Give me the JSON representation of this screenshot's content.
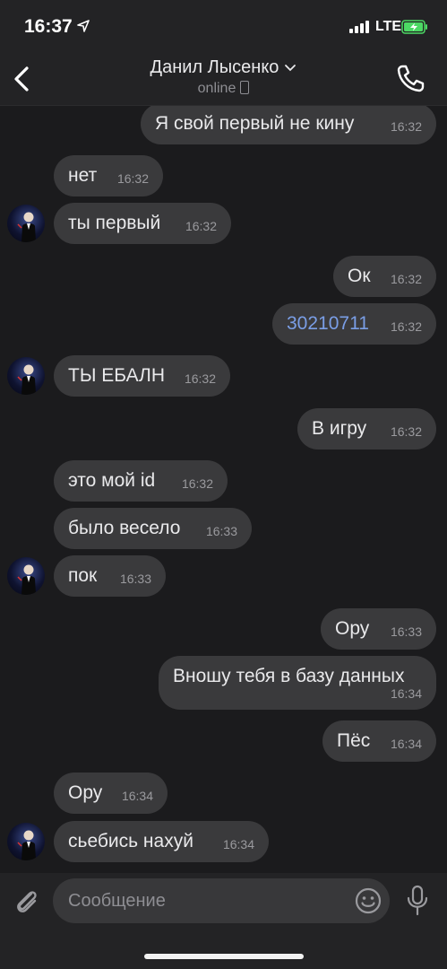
{
  "status_bar": {
    "time": "16:37",
    "network": "LTE",
    "icons": [
      "location-arrow-icon",
      "signal-bars-icon",
      "battery-charging-icon"
    ]
  },
  "header": {
    "back_icon": "chevron-left-icon",
    "contact_name": "Данил Лысенко",
    "contact_status": "online",
    "call_icon": "phone-icon"
  },
  "colors": {
    "background": "#1b1b1d",
    "bar": "#232325",
    "bubble": "#3a3a3c",
    "link": "#7a9ee6",
    "time": "#9a9a9e",
    "battery": "#4cd964"
  },
  "messages": [
    {
      "side": "out",
      "text": "Я свой первый не кину",
      "time": "16:32"
    },
    {
      "side": "in",
      "text": "нет",
      "time": "16:32"
    },
    {
      "side": "in",
      "text": "ты первый",
      "time": "16:32",
      "avatar": true
    },
    {
      "side": "out",
      "text": "Ок",
      "time": "16:32"
    },
    {
      "side": "out",
      "text": "30210711",
      "time": "16:32",
      "link": true
    },
    {
      "side": "in",
      "text": "ТЫ ЕБАЛН",
      "time": "16:32",
      "avatar": true
    },
    {
      "side": "out",
      "text": "В игру",
      "time": "16:32"
    },
    {
      "side": "in",
      "text": "это мой id",
      "time": "16:32"
    },
    {
      "side": "in",
      "text": "было весело",
      "time": "16:33"
    },
    {
      "side": "in",
      "text": "пок",
      "time": "16:33",
      "avatar": true
    },
    {
      "side": "out",
      "text": "Ору",
      "time": "16:33"
    },
    {
      "side": "out",
      "text": "Вношу тебя в базу данных",
      "time": "16:34"
    },
    {
      "side": "out",
      "text": "Пёс",
      "time": "16:34"
    },
    {
      "side": "in",
      "text": "Ору",
      "time": "16:34"
    },
    {
      "side": "in",
      "text": "сьебись нахуй",
      "time": "16:34",
      "avatar": true
    }
  ],
  "input": {
    "placeholder": "Сообщение",
    "value": "",
    "attach_icon": "paperclip-icon",
    "emoji_icon": "emoji-icon",
    "mic_icon": "microphone-icon"
  }
}
